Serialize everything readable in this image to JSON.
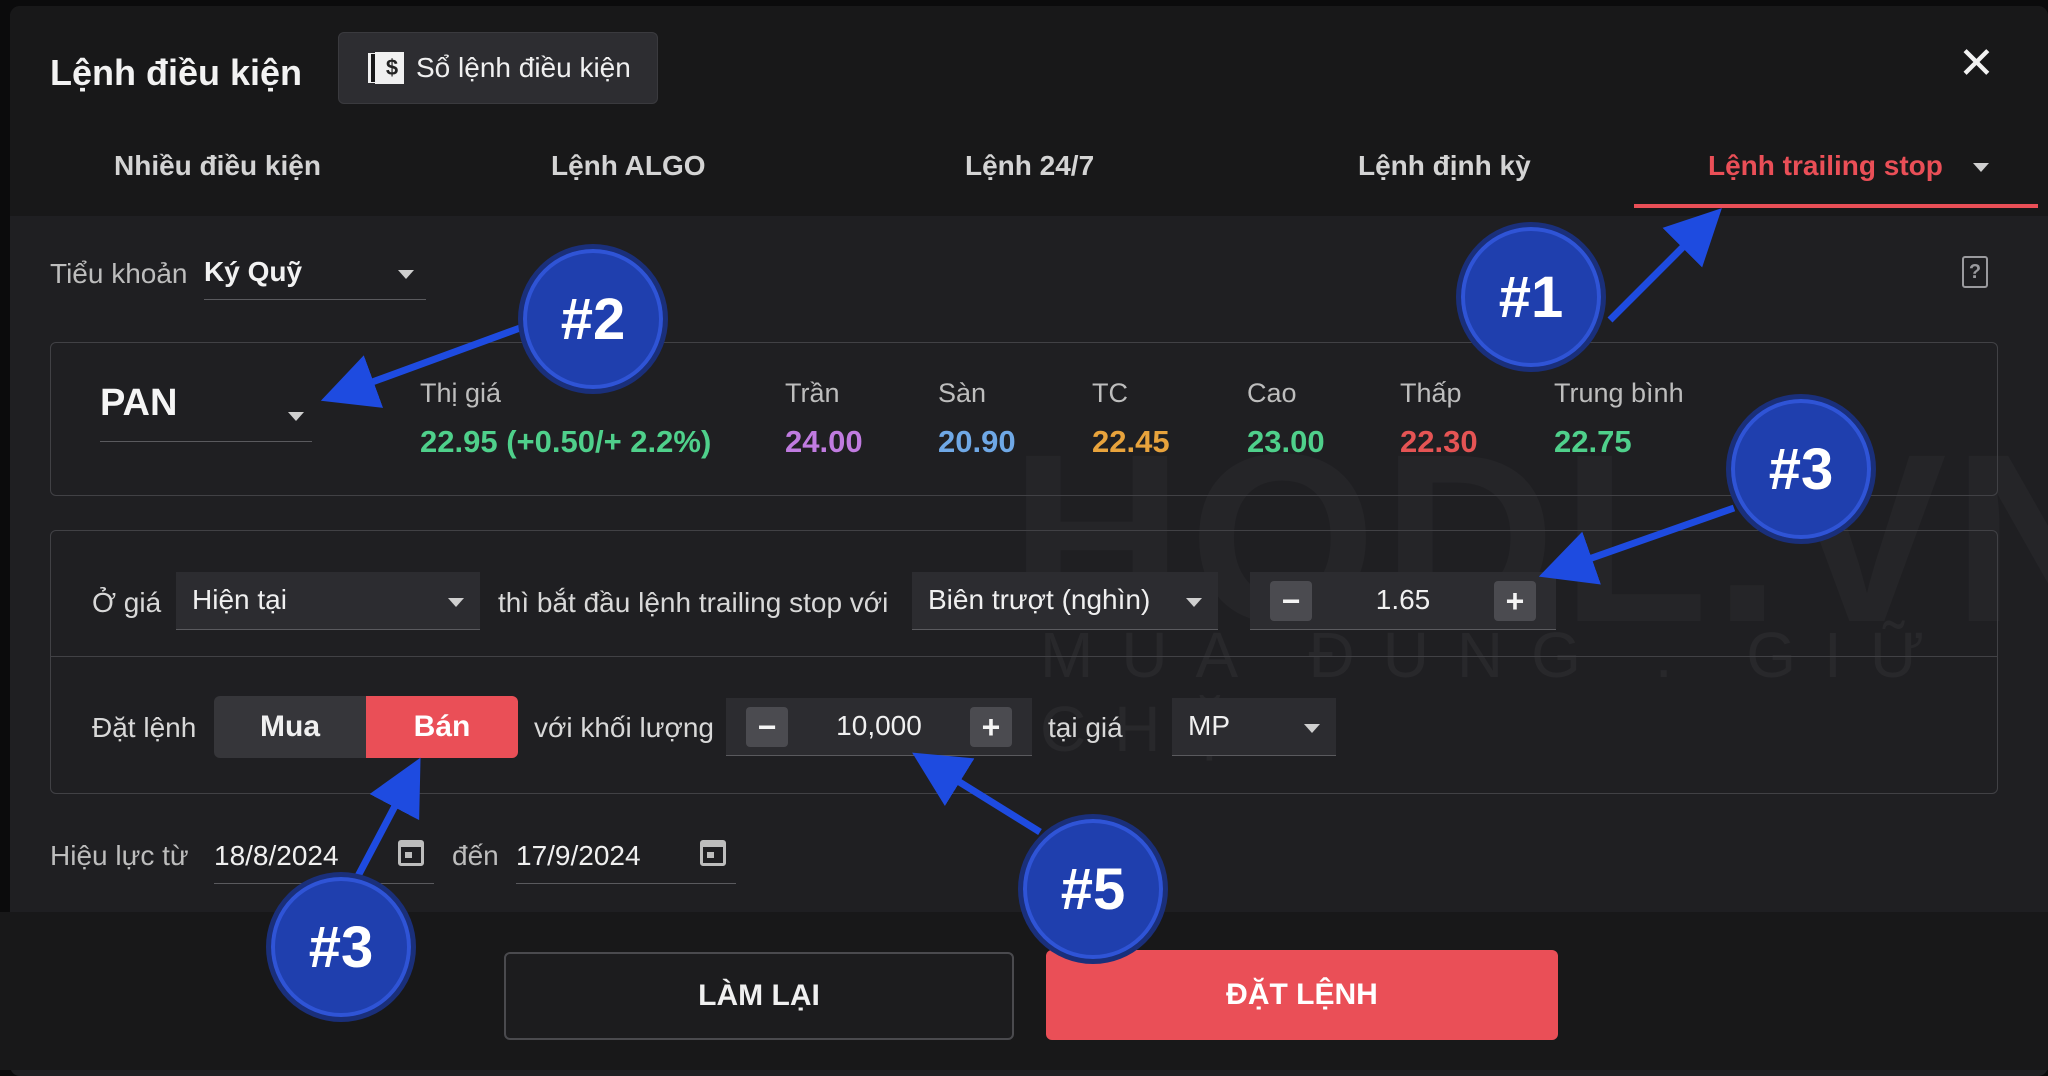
{
  "header": {
    "title": "Lệnh điều kiện",
    "book_button": "Sổ lệnh điều kiện",
    "book_icon_glyph": "$"
  },
  "tabs": [
    {
      "label": "Nhiều điều kiện"
    },
    {
      "label": "Lệnh ALGO"
    },
    {
      "label": "Lệnh 24/7"
    },
    {
      "label": "Lệnh định kỳ"
    },
    {
      "label": "Lệnh trailing stop",
      "active": true
    }
  ],
  "account": {
    "label": "Tiểu khoản",
    "value": "Ký Quỹ"
  },
  "quote": {
    "symbol": "PAN",
    "items": [
      {
        "label": "Thị giá",
        "value": "22.95 (+0.50/+ 2.2%)",
        "color": "#4fd08b"
      },
      {
        "label": "Trần",
        "value": "24.00",
        "color": "#c07be0"
      },
      {
        "label": "Sàn",
        "value": "20.90",
        "color": "#6fa8e6"
      },
      {
        "label": "TC",
        "value": "22.45",
        "color": "#e8a33c"
      },
      {
        "label": "Cao",
        "value": "23.00",
        "color": "#4fd08b"
      },
      {
        "label": "Thấp",
        "value": "22.30",
        "color": "#e55454"
      },
      {
        "label": "Trung bình",
        "value": "22.75",
        "color": "#4fd08b"
      }
    ]
  },
  "condition": {
    "price_label": "Ở giá",
    "price_mode": "Hiện tại",
    "trailing_text": "thì bắt đầu lệnh trailing stop với",
    "trail_type": "Biên trượt (nghìn)",
    "trail_value": "1.65",
    "order_label": "Đặt lệnh",
    "buy_label": "Mua",
    "sell_label": "Bán",
    "qty_text": "với khối lượng",
    "qty_value": "10,000",
    "at_price_text": "tại giá",
    "price_type": "MP"
  },
  "validity": {
    "from_label": "Hiệu lực từ",
    "from_date": "18/8/2024",
    "to_label": "đến",
    "to_date": "17/9/2024"
  },
  "actions": {
    "reset": "LÀM LẠI",
    "submit": "ĐẶT LỆNH"
  },
  "watermark": {
    "brand": "HODL.VN",
    "slogan": "MUA ĐÚNG . GIỮ CHẶT"
  },
  "annotations": [
    {
      "label": "#1"
    },
    {
      "label": "#2"
    },
    {
      "label": "#3"
    },
    {
      "label": "#3"
    },
    {
      "label": "#5"
    }
  ],
  "colors": {
    "accent_red": "#ea4f57",
    "annotation_blue": "#1f3fae",
    "arrow_blue": "#1e4be0"
  }
}
